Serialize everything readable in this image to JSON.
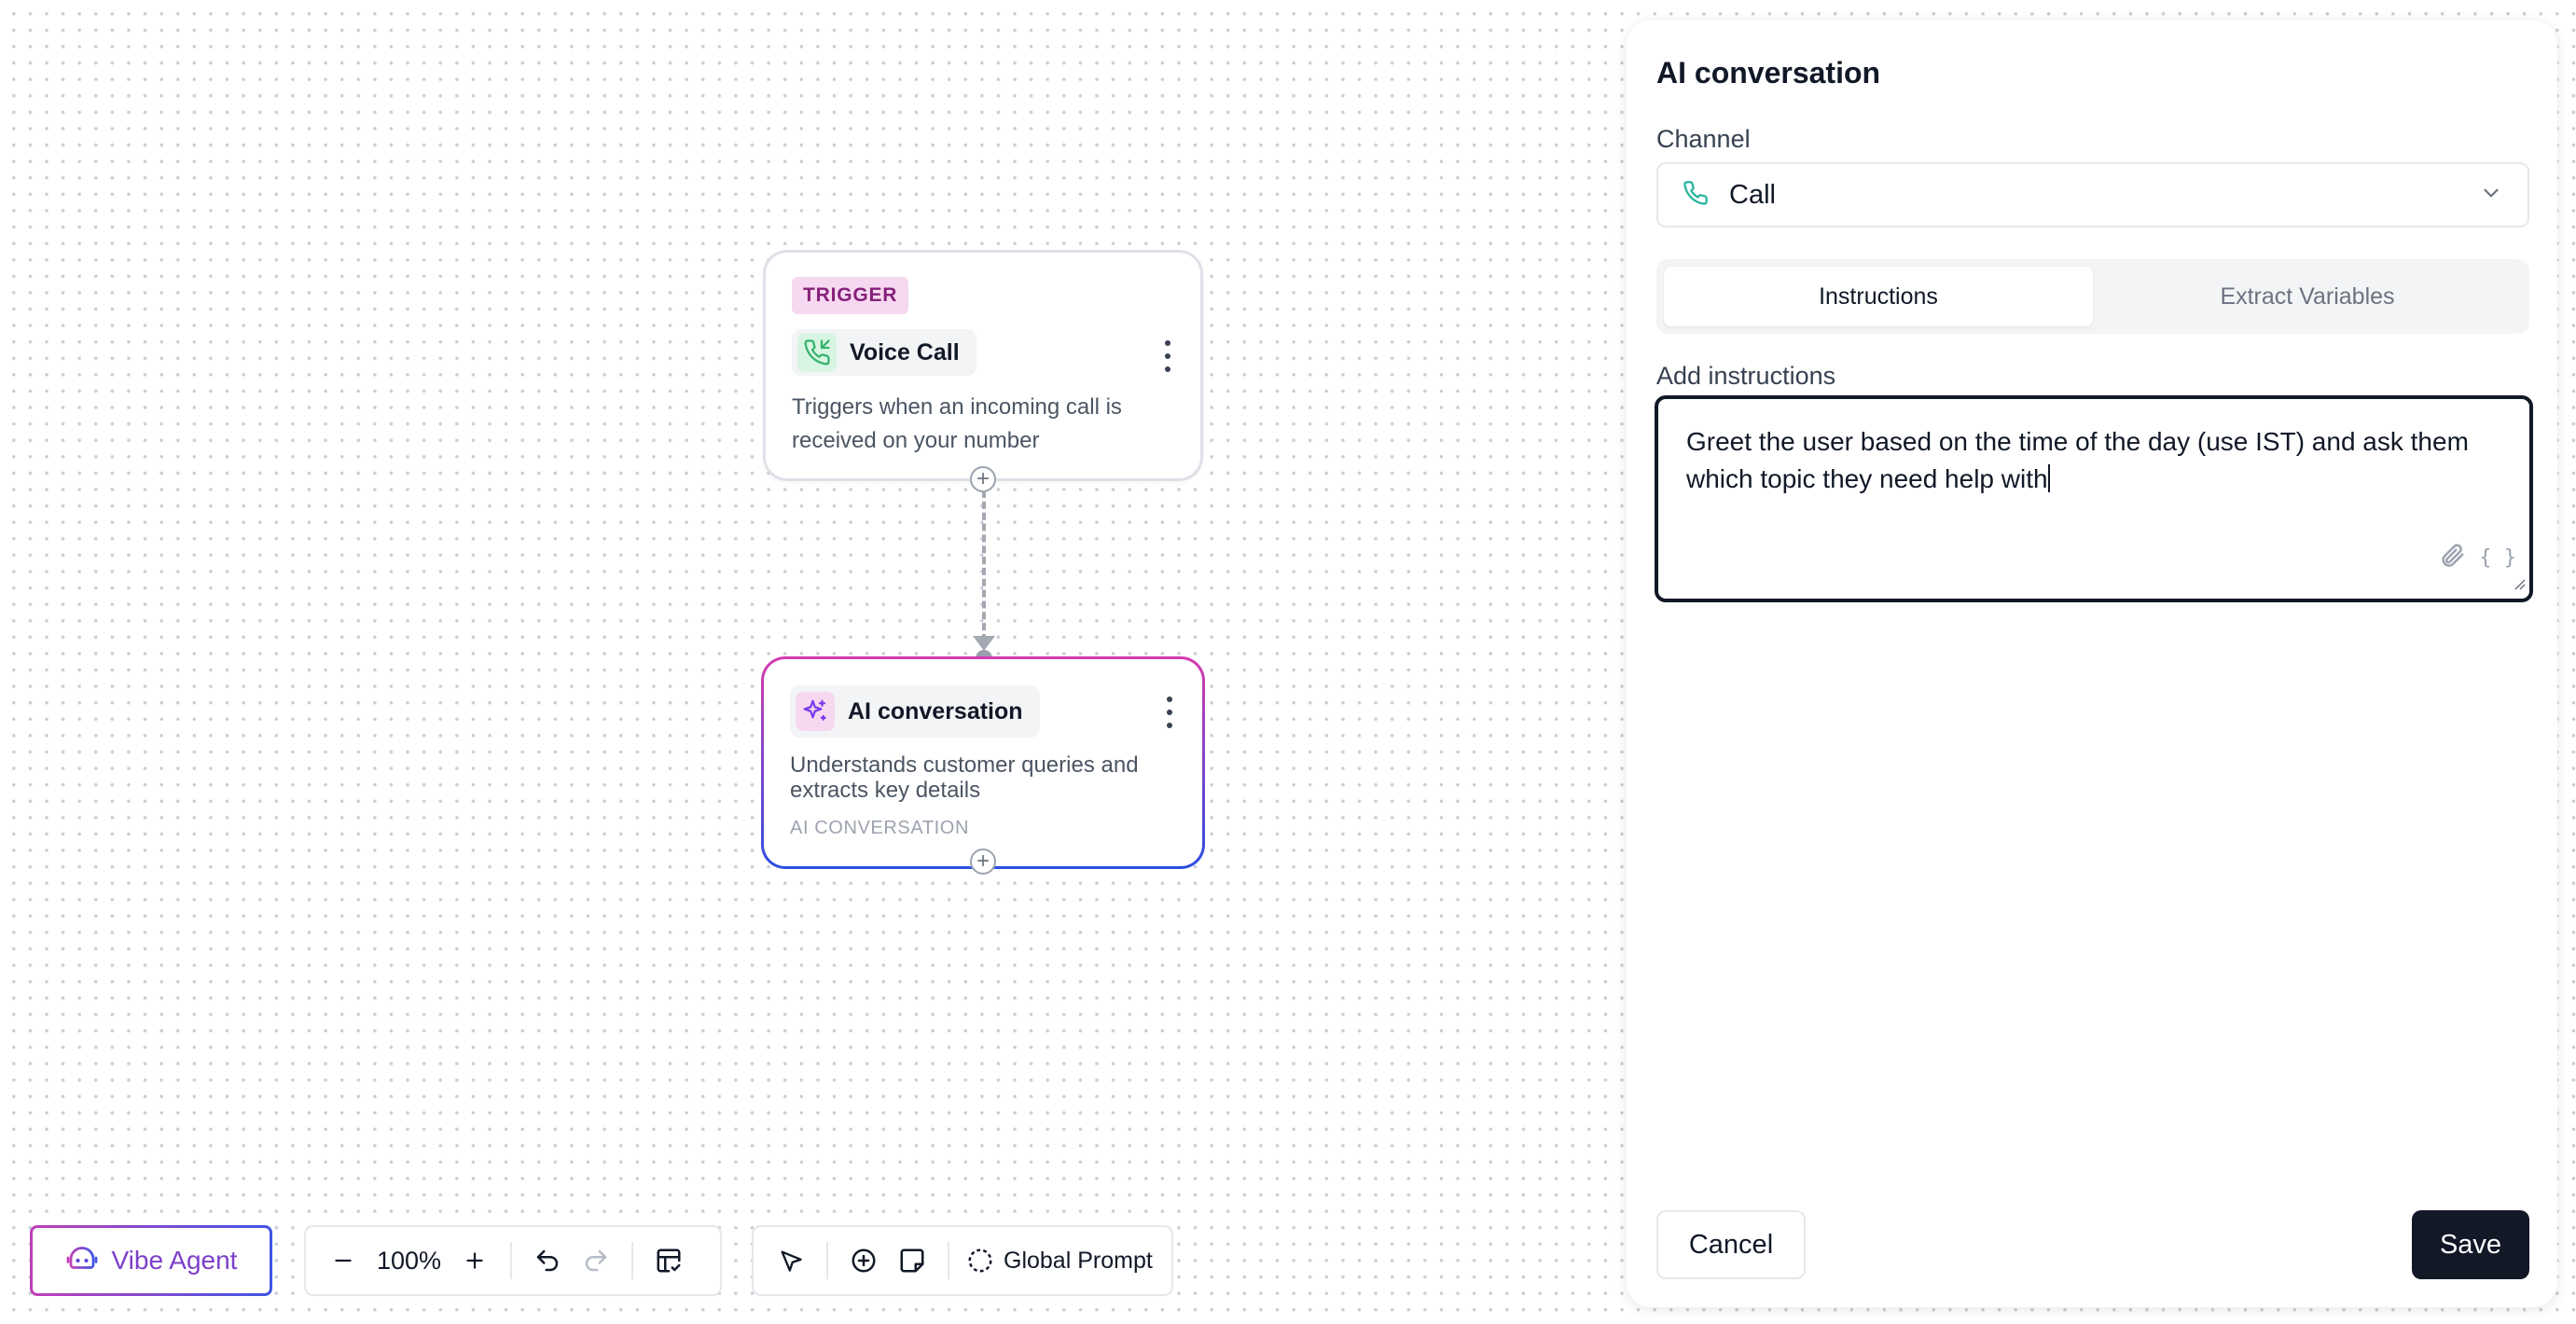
{
  "canvas": {
    "trigger_node": {
      "badge": "TRIGGER",
      "title": "Voice Call",
      "icon": "phone-incoming-icon",
      "description": "Triggers when an incoming call is received on your number"
    },
    "ai_node": {
      "title": "AI conversation",
      "icon": "sparkles-icon",
      "description": "Understands customer queries and extracts key details",
      "type_label": "AI CONVERSATION"
    }
  },
  "toolbar": {
    "vibe_agent_label": "Vibe Agent",
    "zoom_level": "100%",
    "global_prompt_label": "Global Prompt"
  },
  "panel": {
    "title": "AI conversation",
    "channel_label": "Channel",
    "channel_value": "Call",
    "tabs": [
      {
        "label": "Instructions",
        "active": true
      },
      {
        "label": "Extract Variables",
        "active": false
      }
    ],
    "instructions_label": "Add instructions",
    "instructions_value": "Greet the user based on the time of the day (use IST) and ask them which topic they need help with",
    "variables_button": "{ }",
    "cancel_label": "Cancel",
    "save_label": "Save"
  },
  "colors": {
    "accent_pink": "#d63bb0",
    "accent_blue": "#2d4fe0",
    "channel_icon": "#2bb5a0",
    "save_bg": "#121826"
  }
}
